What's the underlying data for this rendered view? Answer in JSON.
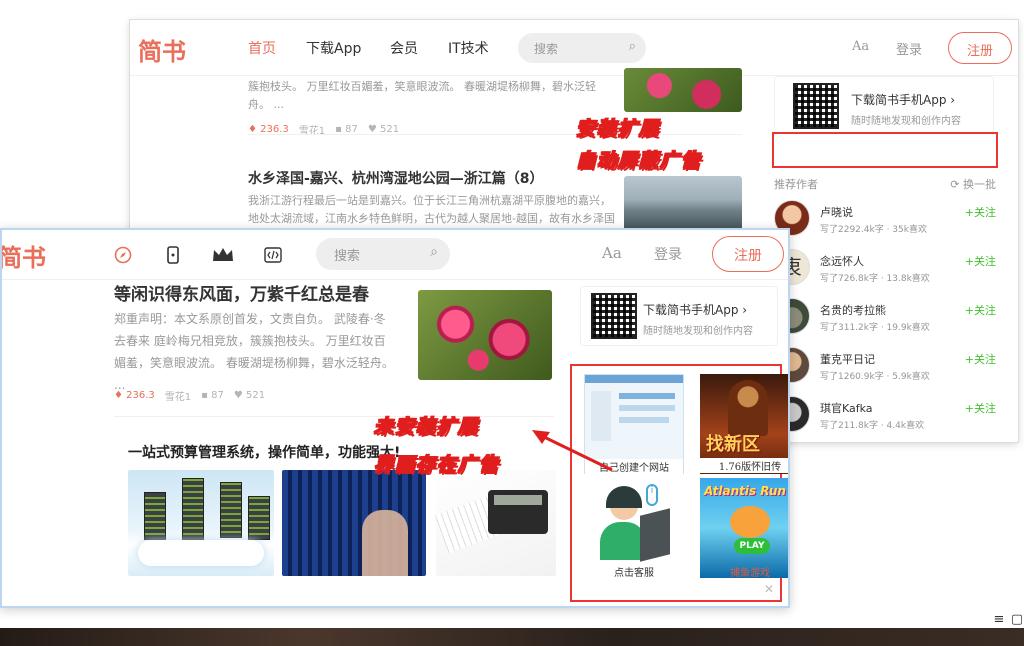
{
  "back": {
    "logo": "简书",
    "nav": [
      "首页",
      "下载App",
      "会员",
      "IT技术"
    ],
    "search_placeholder": "搜索",
    "aa": "Aa",
    "login": "登录",
    "register": "注册",
    "article1_text": "簇抱枝头。 万里红妆百媚羞，笑意眼波流。 春暖湖堤杨柳舞，碧水泛轻舟。 ...",
    "article1_meta": {
      "score": "236.3",
      "author": "雪花1",
      "comments": "87",
      "likes": "521"
    },
    "article2_title": "水乡泽国-嘉兴、杭州湾湿地公园—浙江篇（8）",
    "article2_text": "我浙江游行程最后一站是到嘉兴。位于长江三角洲杭嘉湖平原腹地的嘉兴，地处太湖流域，江南水乡特色鲜明，古代为越人聚居地-越国，故有水乡泽国之称。",
    "app_title": "下载简书手机App",
    "app_sub": "随时随地发现和创作内容",
    "recommend_label": "推荐作者",
    "refresh_label": "换一批",
    "follow_label": "+关注",
    "authors": [
      {
        "name": "卢晓说",
        "stats": "写了2292.4k字 · 35k喜欢"
      },
      {
        "name": "念远怀人",
        "stats": "写了726.8k字 · 13.8k喜欢"
      },
      {
        "name": "名贵的考拉熊",
        "stats": "写了311.2k字 · 19.9k喜欢"
      },
      {
        "name": "董克平日记",
        "stats": "写了1260.9k字 · 5.9k喜欢"
      },
      {
        "name": "琪官Kafka",
        "stats": "写了211.8k字 · 4.4k喜欢"
      }
    ]
  },
  "annotations": {
    "installed_line1": "安装扩展",
    "installed_line2": "自动屏蔽广告",
    "not_installed_line1": "未安装扩展",
    "not_installed_line2": "界面存在广告"
  },
  "front": {
    "logo": "简书",
    "search_placeholder": "搜索",
    "aa": "Aa",
    "login": "登录",
    "register": "注册",
    "article_title": "等闲识得东风面，万紫千红总是春",
    "article_text": "郑重声明：本文系原创首发，文责自负。 武陵春·冬去春来 庭岭梅兄相竞放，簇簇抱枝头。 万里红妆百媚羞，笑意眼波流。 春暖湖堤杨柳舞，碧水泛轻舟。 ...",
    "article_meta": {
      "score": "236.3",
      "author": "雪花1",
      "comments": "87",
      "likes": "521"
    },
    "ad_title": "一站式预算管理系统，操作简单，功能强大!",
    "app_title": "下载简书手机App",
    "app_sub": "随时随地发现和创作内容",
    "side_ads": [
      "自己创建个网站",
      "1.76版怀旧传",
      "点击客服",
      "捕鱼游戏"
    ],
    "game_ad_text": "找新区",
    "fish_ad_text": "Atlantis Run",
    "fish_play": "PLAY"
  },
  "colors": {
    "brand": "#ea6f5a",
    "follow": "#42c02e",
    "annotation": "#e01e1e"
  }
}
